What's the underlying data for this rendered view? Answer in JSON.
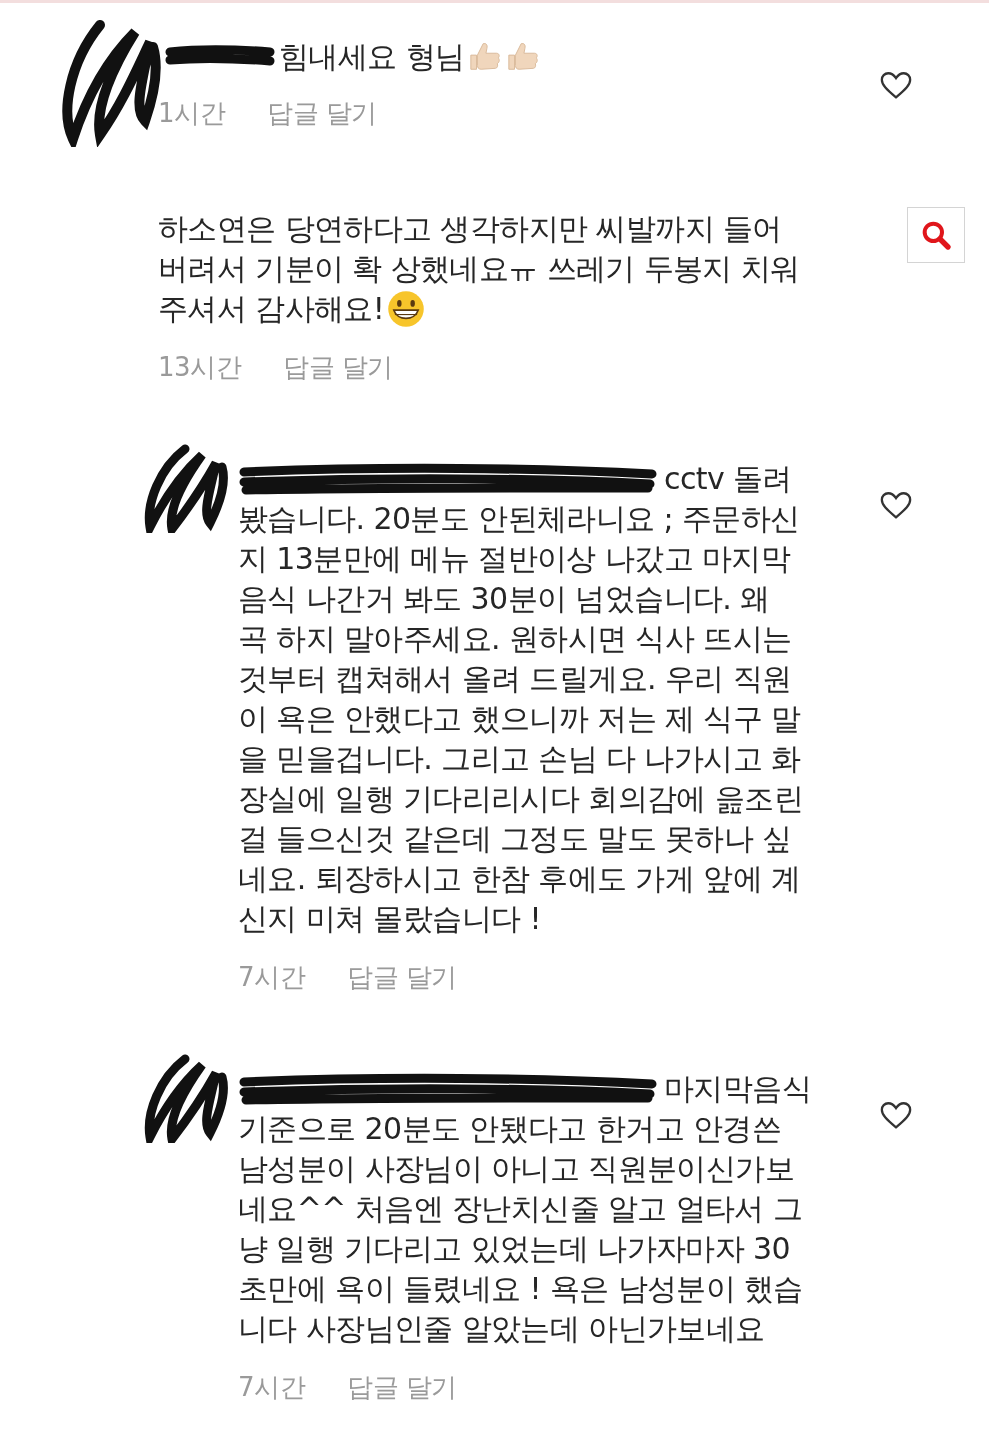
{
  "comments": [
    {
      "kind": "short",
      "lines": [
        "힘내세요 형님"
      ],
      "time": "1시간",
      "reply": "답글 달기"
    },
    {
      "kind": "plain",
      "lines": [
        "하소연은 당연하다고 생각하지만 씨발까지 들어",
        "버려서 기분이 확 상했네요ㅠ 쓰레기 두봉지 치워",
        "주셔서 감사해요!"
      ],
      "time": "13시간",
      "reply": "답글 달기"
    },
    {
      "kind": "long",
      "lines": [
        "cctv 돌려",
        "봤습니다. 20분도 안된체라니요 ; 주문하신",
        "지 13분만에 메뉴 절반이상 나갔고 마지막",
        "음식 나간거 봐도 30분이 넘었습니다. 왜",
        "곡 하지 말아주세요. 원하시면 식사 뜨시는",
        "것부터 캡쳐해서 올려 드릴게요. 우리 직원",
        "이 욕은 안했다고 했으니까 저는 제 식구 말",
        "을 믿을겁니다. 그리고 손님 다 나가시고 화",
        "장실에 일행 기다리리시다 회의감에 읊조린",
        "걸 들으신것 같은데 그정도 말도 못하나 싶",
        "네요. 퇴장하시고 한참 후에도 가게 앞에 계",
        "신지 미쳐 몰랐습니다 !"
      ],
      "time": "7시간",
      "reply": "답글 달기"
    },
    {
      "kind": "long",
      "lines": [
        "마지막음식",
        "기준으로 20분도 안됐다고 한거고 안경쓴",
        "남성분이 사장님이 아니고 직원분이신가보",
        "네요^^ 처음엔 장난치신줄 알고 얼타서 그",
        "냥 일행 기다리고 있었는데 나가자마자 30",
        "초만에 욕이 들렸네요 ! 욕은 남성분이 했습",
        "니다 사장님인줄 알았는데 아닌가보네요"
      ],
      "time": "7시간",
      "reply": "답글 달기"
    }
  ]
}
